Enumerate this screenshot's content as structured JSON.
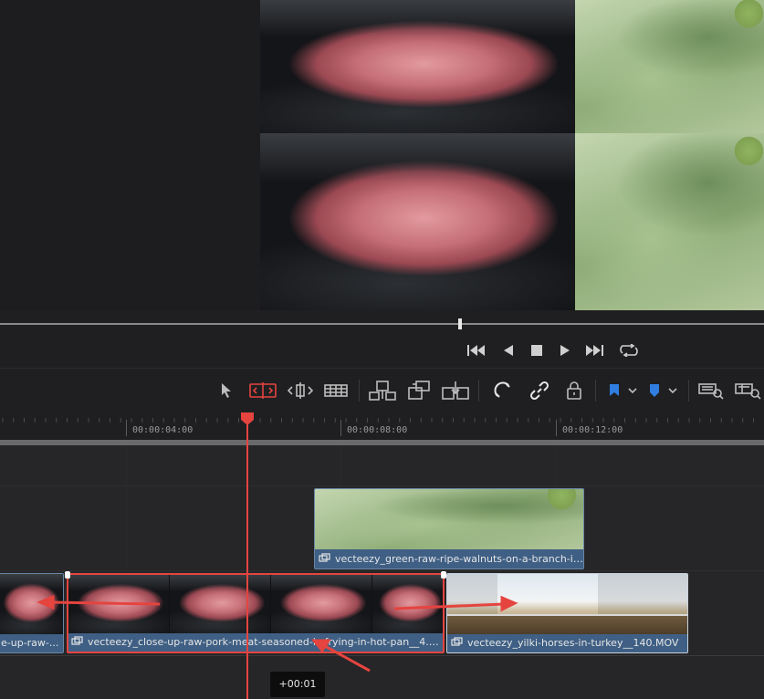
{
  "ruler": {
    "timecodes": [
      "00:00:04:00",
      "00:00:08:00",
      "00:00:12:00"
    ]
  },
  "clips": {
    "v2": {
      "name": "vecteezy_green-raw-ripe-walnuts-on-a-branch-in..."
    },
    "v1_left": {
      "name": "e-up-raw-..."
    },
    "v1_selected": {
      "name": "vecteezy_close-up-raw-pork-meat-seasoned-is-frying-in-hot-pan__4.mov"
    },
    "v1_right": {
      "name": "vecteezy_yilki-horses-in-turkey__140.MOV"
    }
  },
  "tooltip": {
    "offset": "+00:01"
  },
  "colors": {
    "accent_red": "#e5443f",
    "clip_blue": "#3f5f84",
    "flag_blue": "#2f7ee0"
  },
  "icons": {
    "transport": [
      "skip-to-start-icon",
      "play-reverse-icon",
      "stop-icon",
      "play-icon",
      "skip-to-end-icon",
      "loop-icon"
    ],
    "tools": [
      "selection-arrow-icon",
      "trim-edit-icon",
      "dynamic-trim-icon",
      "blade-icon",
      "insert-clip-icon",
      "overwrite-clip-icon",
      "replace-clip-icon",
      "snapping-icon",
      "linked-selection-icon",
      "position-lock-icon",
      "flag-icon",
      "marker-icon",
      "zoom-full-icon",
      "zoom-detail-icon"
    ]
  }
}
